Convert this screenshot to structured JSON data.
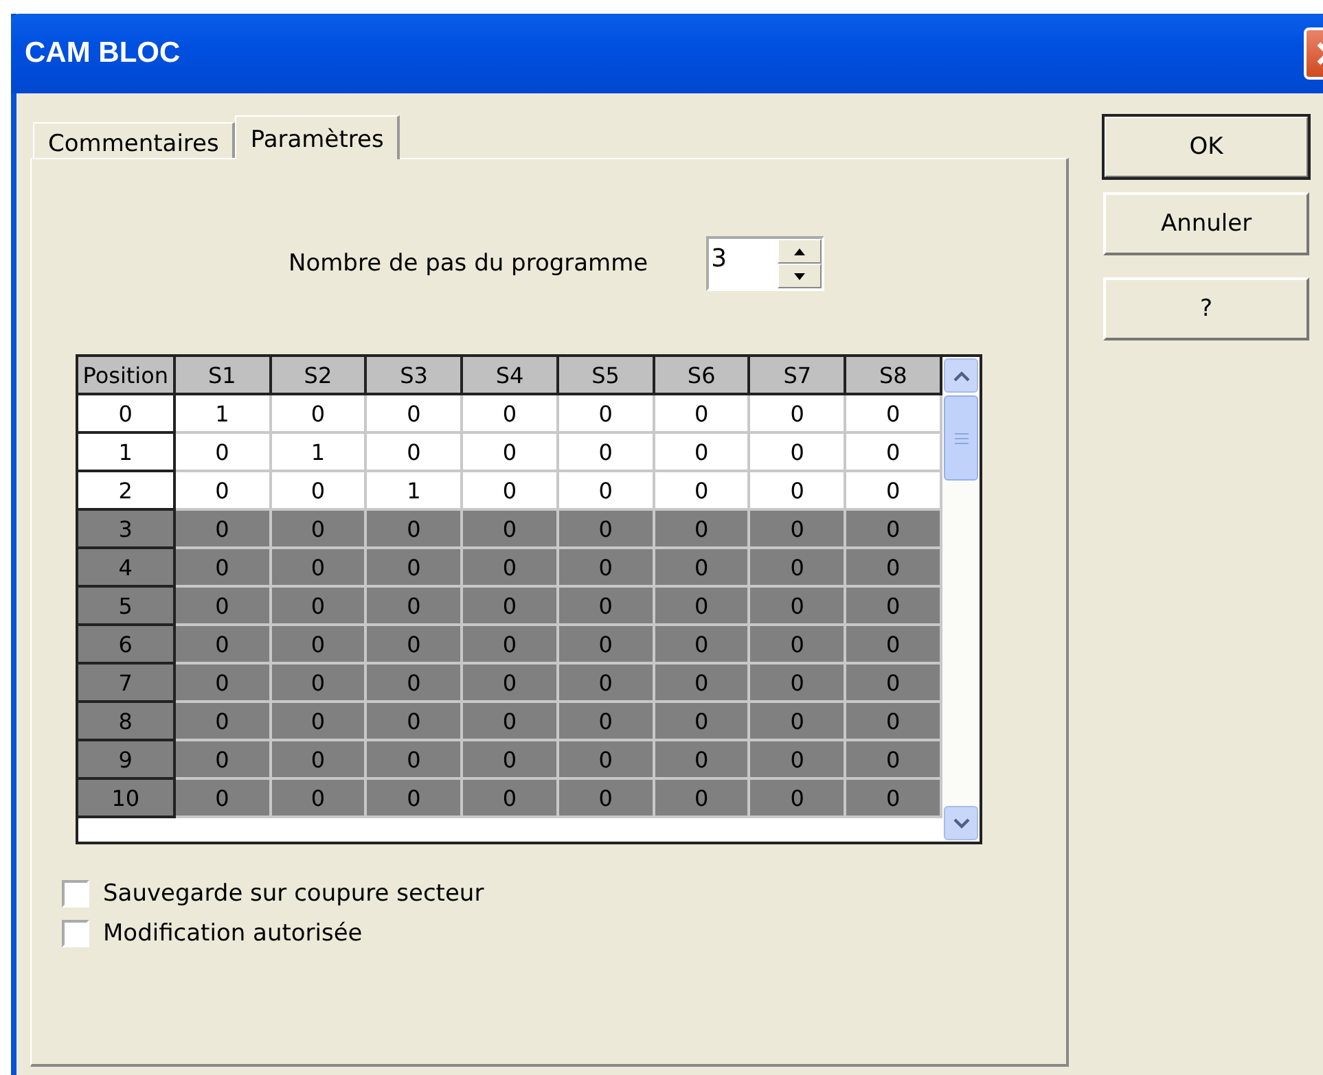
{
  "window": {
    "title": "CAM BLOC"
  },
  "tabs": [
    {
      "label": "Commentaires",
      "selected": false
    },
    {
      "label": "Paramètres",
      "selected": true
    }
  ],
  "steps": {
    "label": "Nombre de pas du programme",
    "value": "3"
  },
  "table": {
    "columns": [
      "Position",
      "S1",
      "S2",
      "S3",
      "S4",
      "S5",
      "S6",
      "S7",
      "S8"
    ],
    "rows": [
      {
        "enabled": true,
        "cells": [
          "0",
          "1",
          "0",
          "0",
          "0",
          "0",
          "0",
          "0",
          "0"
        ]
      },
      {
        "enabled": true,
        "cells": [
          "1",
          "0",
          "1",
          "0",
          "0",
          "0",
          "0",
          "0",
          "0"
        ]
      },
      {
        "enabled": true,
        "cells": [
          "2",
          "0",
          "0",
          "1",
          "0",
          "0",
          "0",
          "0",
          "0"
        ]
      },
      {
        "enabled": false,
        "cells": [
          "3",
          "0",
          "0",
          "0",
          "0",
          "0",
          "0",
          "0",
          "0"
        ]
      },
      {
        "enabled": false,
        "cells": [
          "4",
          "0",
          "0",
          "0",
          "0",
          "0",
          "0",
          "0",
          "0"
        ]
      },
      {
        "enabled": false,
        "cells": [
          "5",
          "0",
          "0",
          "0",
          "0",
          "0",
          "0",
          "0",
          "0"
        ]
      },
      {
        "enabled": false,
        "cells": [
          "6",
          "0",
          "0",
          "0",
          "0",
          "0",
          "0",
          "0",
          "0"
        ]
      },
      {
        "enabled": false,
        "cells": [
          "7",
          "0",
          "0",
          "0",
          "0",
          "0",
          "0",
          "0",
          "0"
        ]
      },
      {
        "enabled": false,
        "cells": [
          "8",
          "0",
          "0",
          "0",
          "0",
          "0",
          "0",
          "0",
          "0"
        ]
      },
      {
        "enabled": false,
        "cells": [
          "9",
          "0",
          "0",
          "0",
          "0",
          "0",
          "0",
          "0",
          "0"
        ]
      },
      {
        "enabled": false,
        "cells": [
          "10",
          "0",
          "0",
          "0",
          "0",
          "0",
          "0",
          "0",
          "0"
        ]
      }
    ]
  },
  "options": [
    {
      "label": "Sauvegarde sur coupure secteur",
      "checked": false
    },
    {
      "label": "Modification autorisée",
      "checked": false
    }
  ],
  "buttons": [
    "OK",
    "Annuler",
    "?"
  ]
}
